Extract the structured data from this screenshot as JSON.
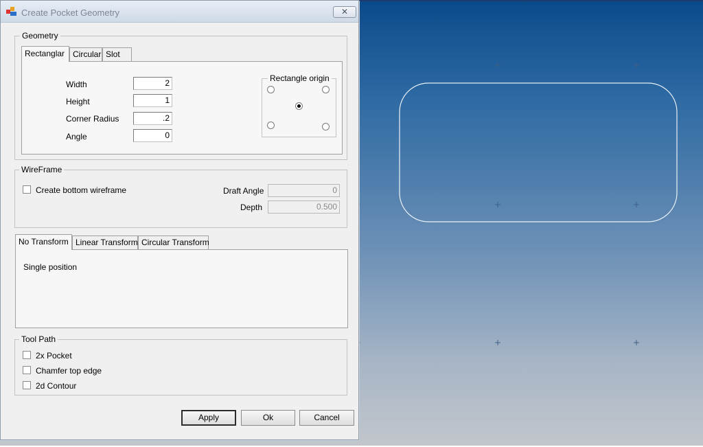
{
  "window": {
    "title": "Create Pocket Geometry",
    "close_glyph": "✕"
  },
  "geometry": {
    "legend": "Geometry",
    "tabs": [
      "Rectanglar",
      "Circular",
      "Slot"
    ],
    "active_tab": "Rectanglar",
    "fields": {
      "width": {
        "label": "Width",
        "value": "2"
      },
      "height": {
        "label": "Height",
        "value": "1"
      },
      "corner_radius": {
        "label": "Corner Radius",
        "value": ".2"
      },
      "angle": {
        "label": "Angle",
        "value": "0"
      }
    },
    "origin": {
      "legend": "Rectangle origin",
      "selected": "center"
    }
  },
  "wireframe": {
    "legend": "WireFrame",
    "create_bottom_label": "Create bottom wireframe",
    "create_bottom_checked": false,
    "draft_angle": {
      "label": "Draft Angle",
      "value": "0"
    },
    "depth": {
      "label": "Depth",
      "value": "0.500"
    }
  },
  "transform": {
    "tabs": [
      "No Transform",
      "Linear Transform",
      "Circular Transform"
    ],
    "active_tab": "No Transform",
    "content": "Single position"
  },
  "toolpath": {
    "legend": "Tool Path",
    "options": [
      {
        "label": "2x Pocket",
        "checked": false
      },
      {
        "label": "Chamfer top edge",
        "checked": false
      },
      {
        "label": "2d Contour",
        "checked": false
      }
    ]
  },
  "buttons": {
    "apply": "Apply",
    "ok": "Ok",
    "cancel": "Cancel"
  },
  "viewport": {
    "gradient_top": "#0b4a8a",
    "gradient_bottom": "#c2c6cc",
    "outline_color": "#ffffff",
    "grid_marker": "+"
  }
}
